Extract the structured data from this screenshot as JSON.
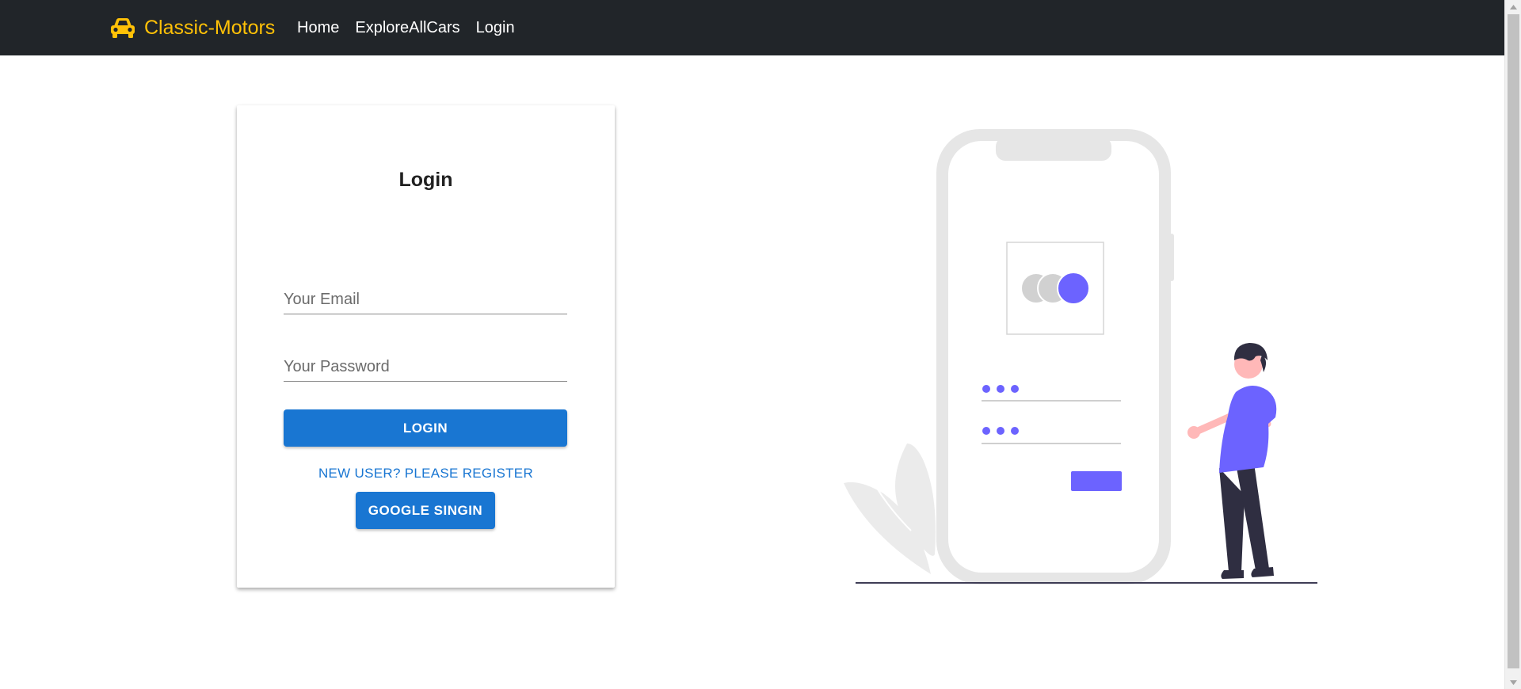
{
  "navbar": {
    "brand_label": "Classic-Motors",
    "brand_icon": "car-icon",
    "brand_color": "#ffc107",
    "background": "#212529",
    "links": [
      {
        "label": "Home"
      },
      {
        "label": "ExploreAllCars"
      },
      {
        "label": "Login"
      }
    ]
  },
  "login_form": {
    "title": "Login",
    "email_placeholder": "Your Email",
    "password_placeholder": "Your Password",
    "login_button_label": "LOGIN",
    "register_link_label": "NEW USER? PLEASE REGISTER",
    "google_button_label": "GOOGLE SINGIN",
    "accent_color": "#1976d2"
  },
  "illustration": {
    "accent_color": "#6c63ff",
    "icon": "phone-login-illustration"
  }
}
